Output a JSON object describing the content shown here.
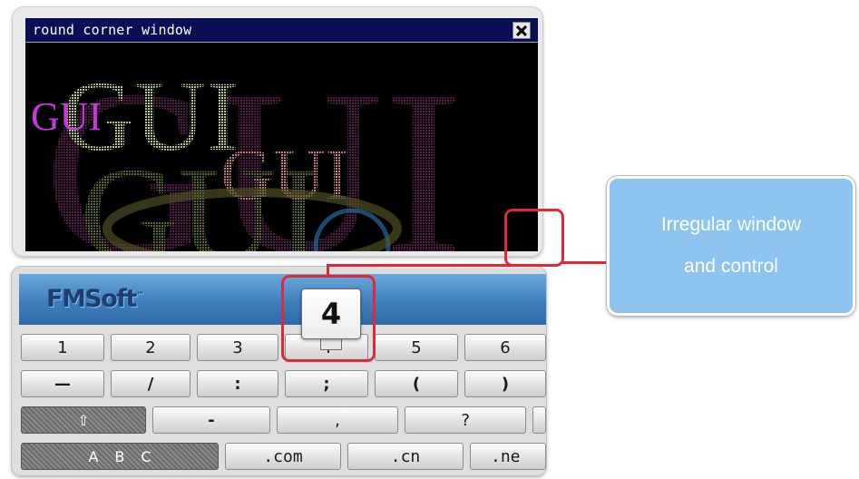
{
  "window": {
    "title": "round corner window",
    "background_words": [
      "GUI",
      "GUI",
      "GUI",
      "GUI",
      "GUI"
    ]
  },
  "keyboard": {
    "logo": "FMSoft",
    "logo_tm": "™",
    "popup_key": "4",
    "row1": [
      "1",
      "2",
      "3",
      "4",
      "5",
      "6"
    ],
    "row2": [
      "—",
      "/",
      ":",
      ";",
      "(",
      ")"
    ],
    "row3": [
      "⇧",
      "-",
      ",",
      "?"
    ],
    "row4": {
      "abc": [
        "A",
        "B",
        "C"
      ],
      "domains": [
        ".com",
        ".cn",
        ".ne"
      ]
    }
  },
  "callout": {
    "line1": "Irregular window",
    "line2": "and control"
  },
  "colors": {
    "accent_red": "#e0283c",
    "callout_blue": "#8ec4ef",
    "title_bar": "#0a0f55",
    "keyboard_header": "#3f7fbd"
  }
}
